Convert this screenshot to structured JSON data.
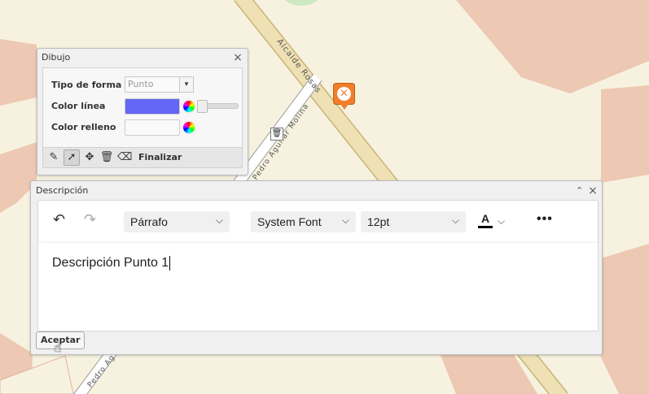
{
  "map": {
    "streets": {
      "alcalde_rosas": "Alcalde Rosas",
      "pedro_aguilar_molina": "Pedro Aguilar Molina",
      "pedro_ag": "Pedro Ag"
    },
    "marker_icon": "close-marker-icon",
    "colors": {
      "background": "#f7f2df",
      "building": "#edc8b2",
      "road": "#efe1b4",
      "road_edge": "#c8b47a",
      "park": "#cfe8c4"
    }
  },
  "dibujo": {
    "title": "Dibujo",
    "rows": {
      "tipo_forma_label": "Tipo de forma",
      "tipo_forma_value": "Punto",
      "color_linea_label": "Color línea",
      "color_relleno_label": "Color relleno"
    },
    "line_color": "#6466f5",
    "fill_color": "#fafafa",
    "toolbar": {
      "finalizar_label": "Finalizar",
      "tools": [
        "pencil-icon",
        "pointer-icon",
        "move-icon",
        "trash-icon",
        "eraser-icon"
      ]
    }
  },
  "descripcion": {
    "title": "Descripción",
    "editor": {
      "block_format": "Párrafo",
      "font_family": "System Font",
      "font_size": "12pt",
      "font_color_letter": "A",
      "more_label": "•••",
      "content": "Descripción Punto 1"
    },
    "accept_label": "Aceptar"
  }
}
